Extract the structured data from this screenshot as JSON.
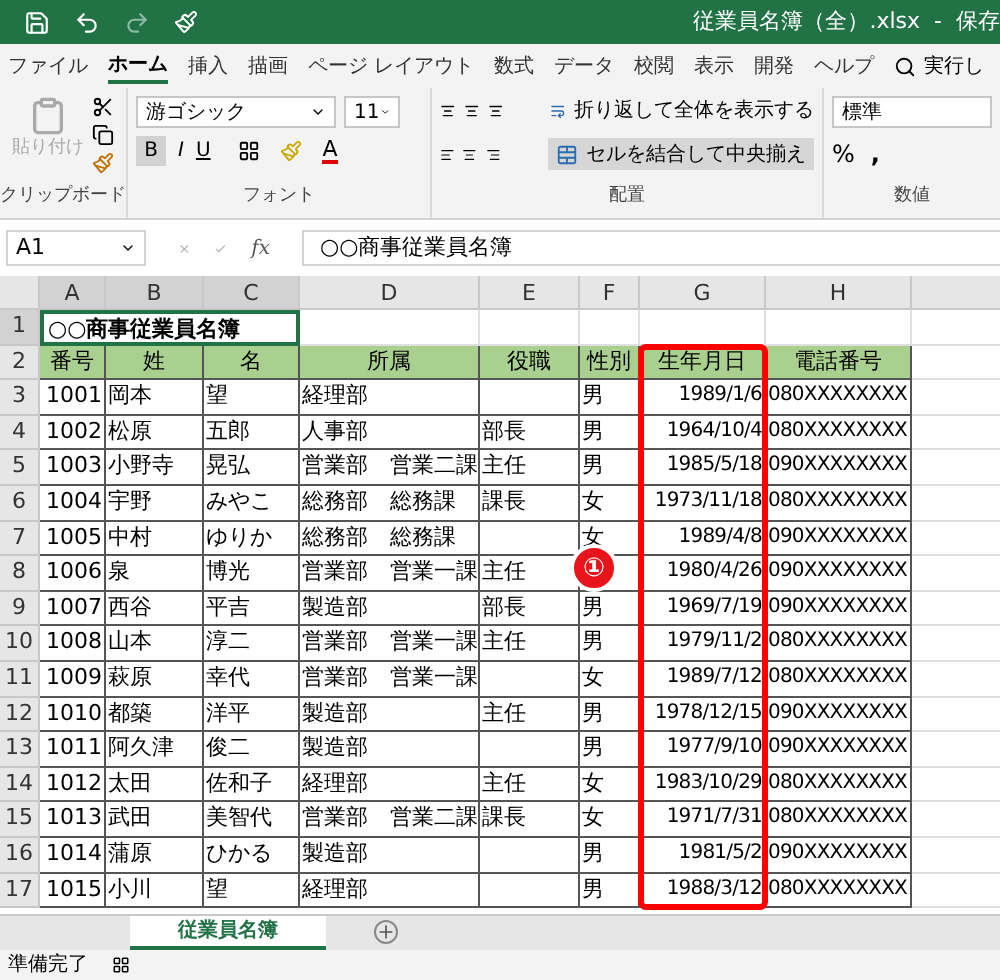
{
  "window": {
    "title": "従業員名簿（全）.xlsx  -  保存"
  },
  "ribbon_tabs": [
    {
      "label": "ファイル",
      "selected": false
    },
    {
      "label": "ホーム",
      "selected": true
    },
    {
      "label": "挿入",
      "selected": false
    },
    {
      "label": "描画",
      "selected": false
    },
    {
      "label": "ページ レイアウト",
      "selected": false
    },
    {
      "label": "数式",
      "selected": false
    },
    {
      "label": "データ",
      "selected": false
    },
    {
      "label": "校閲",
      "selected": false
    },
    {
      "label": "表示",
      "selected": false
    },
    {
      "label": "開発",
      "selected": false
    },
    {
      "label": "ヘルプ",
      "selected": false
    }
  ],
  "tell_me": "実行し",
  "ribbon": {
    "clipboard": {
      "paste": "貼り付け",
      "label": "クリップボード"
    },
    "font": {
      "name": "游ゴシック",
      "size": "11",
      "bold": "B",
      "italic": "I",
      "underline": "U",
      "font_color_button": "A",
      "label": "フォント"
    },
    "alignment": {
      "wrap": "折り返して全体を表示する",
      "merge": "セルを結合して中央揃え",
      "label": "配置"
    },
    "number": {
      "format": "標準",
      "percent": "%",
      "comma": ",",
      "label": "数値"
    }
  },
  "formula_bar": {
    "name_box": "A1",
    "fx": "fx",
    "value": "○○商事従業員名簿"
  },
  "columns": [
    {
      "label": "A",
      "highlighted": false
    },
    {
      "label": "B",
      "highlighted": false
    },
    {
      "label": "C",
      "highlighted": false
    },
    {
      "label": "D",
      "highlighted": false
    },
    {
      "label": "E",
      "highlighted": false
    },
    {
      "label": "F",
      "highlighted": false
    },
    {
      "label": "G",
      "highlighted": true
    },
    {
      "label": "H",
      "highlighted": false
    }
  ],
  "row_labels": [
    "1",
    "2",
    "3",
    "4",
    "5",
    "6",
    "7",
    "8",
    "9",
    "10",
    "11",
    "12",
    "13",
    "14",
    "15",
    "16",
    "17"
  ],
  "title_cell": "○○商事従業員名簿",
  "headers": [
    "番号",
    "姓",
    "名",
    "所属",
    "役職",
    "性別",
    "生年月日",
    "電話番号"
  ],
  "rows": [
    {
      "no": "1001",
      "last": "岡本",
      "first": "望",
      "dept": "経理部",
      "gender": "男",
      "birth": "1989/1/6",
      "phone": "080XXXXXXXX"
    },
    {
      "no": "1002",
      "last": "松原",
      "first": "五郎",
      "dept": "人事部",
      "title": "部長",
      "gender": "男",
      "birth": "1964/10/4",
      "phone": "080XXXXXXXX"
    },
    {
      "no": "1003",
      "last": "小野寺",
      "first": "晃弘",
      "dept": "営業部　営業二課",
      "title": "主任",
      "gender": "男",
      "birth": "1985/5/18",
      "phone": "090XXXXXXXX"
    },
    {
      "no": "1004",
      "last": "宇野",
      "first": "みやこ",
      "dept": "総務部　総務課",
      "title": "課長",
      "gender": "女",
      "birth": "1973/11/18",
      "phone": "080XXXXXXXX"
    },
    {
      "no": "1005",
      "last": "中村",
      "first": "ゆりか",
      "dept": "総務部　総務課",
      "gender": "女",
      "birth": "1989/4/8",
      "phone": "090XXXXXXXX"
    },
    {
      "no": "1006",
      "last": "泉",
      "first": "博光",
      "dept": "営業部　営業一課",
      "title": "主任",
      "birth": "1980/4/26",
      "phone": "090XXXXXXXX"
    },
    {
      "no": "1007",
      "last": "西谷",
      "first": "平吉",
      "dept": "製造部",
      "title": "部長",
      "gender": "男",
      "birth": "1969/7/19",
      "phone": "090XXXXXXXX"
    },
    {
      "no": "1008",
      "last": "山本",
      "first": "淳二",
      "dept": "営業部　営業一課",
      "title": "主任",
      "gender": "男",
      "birth": "1979/11/2",
      "phone": "080XXXXXXXX"
    },
    {
      "no": "1009",
      "last": "萩原",
      "first": "幸代",
      "dept": "営業部　営業一課",
      "gender": "女",
      "birth": "1989/7/12",
      "phone": "080XXXXXXXX"
    },
    {
      "no": "1010",
      "last": "都築",
      "first": "洋平",
      "dept": "製造部",
      "title": "主任",
      "gender": "男",
      "birth": "1978/12/15",
      "phone": "090XXXXXXXX"
    },
    {
      "no": "1011",
      "last": "阿久津",
      "first": "俊二",
      "dept": "製造部",
      "gender": "男",
      "birth": "1977/9/10",
      "phone": "090XXXXXXXX"
    },
    {
      "no": "1012",
      "last": "太田",
      "first": "佐和子",
      "dept": "経理部",
      "title": "主任",
      "gender": "女",
      "birth": "1983/10/29",
      "phone": "080XXXXXXXX"
    },
    {
      "no": "1013",
      "last": "武田",
      "first": "美智代",
      "dept": "営業部　営業二課",
      "title": "課長",
      "gender": "女",
      "birth": "1971/7/31",
      "phone": "080XXXXXXXX"
    },
    {
      "no": "1014",
      "last": "蒲原",
      "first": "ひかる",
      "dept": "製造部",
      "gender": "男",
      "birth": "1981/5/2",
      "phone": "090XXXXXXXX"
    },
    {
      "no": "1015",
      "last": "小川",
      "first": "望",
      "dept": "経理部",
      "gender": "男",
      "birth": "1988/3/12",
      "phone": "080XXXXXXXX"
    }
  ],
  "annotation": {
    "label": "①"
  },
  "sheet_tabs": [
    {
      "label": "従業員名簿",
      "selected": true
    }
  ],
  "status": "準備完了"
}
